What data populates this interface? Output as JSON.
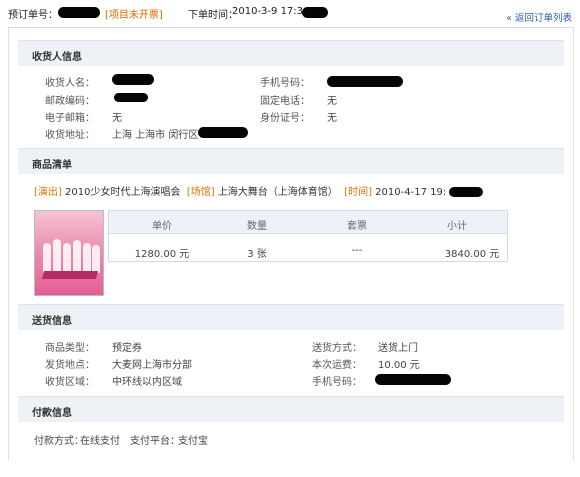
{
  "order": {
    "order_no_label": "预订单号：",
    "status_badge": "[项目未开票]",
    "order_time_label": "下单时间：",
    "order_time_value": "2010-3-9 17:3",
    "back_link": "返回订单列表"
  },
  "consignee": {
    "title": "收货人信息",
    "name_label": "收货人名：",
    "zip_label": "邮政编码：",
    "email_label": "电子邮箱：",
    "email_value": "无",
    "address_label": "收货地址：",
    "address_value": "上海 上海市 闵行区",
    "mobile_label": "手机号码：",
    "phone_label": "固定电话：",
    "phone_value": "无",
    "id_label": "身份证号：",
    "id_value": "无"
  },
  "items": {
    "title": "商品清单",
    "show_tag": "[演出]",
    "show_name": "2010少女时代上海演唱会",
    "venue_tag": "[场馆]",
    "venue_name": "上海大舞台（上海体育馆）",
    "time_tag": "[时间]",
    "time_value": "2010-4-17 19:",
    "headers": [
      "单价",
      "数量",
      "套票",
      "小计"
    ],
    "row": [
      "1280.00 元",
      "3 张",
      "---",
      "3840.00 元"
    ]
  },
  "delivery": {
    "title": "送货信息",
    "type_label": "商品类型：",
    "type_value": "预定券",
    "from_label": "发货地点：",
    "from_value": "大麦网上海市分部",
    "area_label": "收货区域：",
    "area_value": "中环线以内区域",
    "method_label": "送货方式：",
    "method_value": "送货上门",
    "fee_label": "本次运费：",
    "fee_value": "10.00 元",
    "mobile_label": "手机号码："
  },
  "payment": {
    "title": "付款信息",
    "method_label": "付款方式：",
    "method_value": "在线支付",
    "platform_label": "支付平台：",
    "platform_value": "支付宝"
  }
}
